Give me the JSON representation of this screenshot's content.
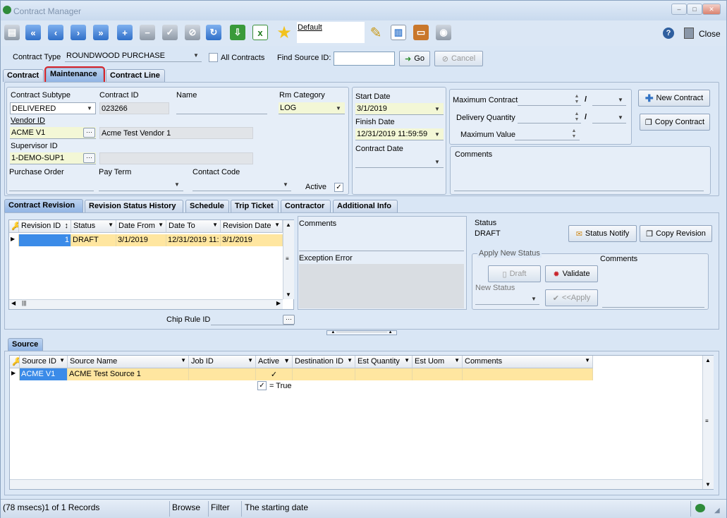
{
  "window": {
    "title": "Contract Manager",
    "close_label": "Close"
  },
  "toolbar": {
    "layout_name": "Default"
  },
  "filterbar": {
    "contract_type_label": "Contract Type",
    "contract_type_value": "ROUNDWOOD PURCHASE",
    "all_contracts_label": "All Contracts",
    "find_source_label": "Find Source ID:",
    "find_source_value": "",
    "go_label": "Go",
    "cancel_label": "Cancel"
  },
  "top_tabs": [
    {
      "label": "Contract"
    },
    {
      "label": "Maintenance"
    },
    {
      "label": "Contract Line"
    }
  ],
  "main": {
    "contract_subtype_label": "Contract Subtype",
    "contract_subtype": "DELIVERED",
    "contract_id_label": "Contract ID",
    "contract_id": "023266",
    "name_label": "Name",
    "name": "",
    "rm_category_label": "Rm Category",
    "rm_category": "LOG",
    "vendor_id_label": "Vendor ID",
    "vendor_id": "ACME V1",
    "vendor_name": "Acme Test Vendor 1",
    "supervisor_id_label": "Supervisor ID",
    "supervisor_id": "1-DEMO-SUP1",
    "supervisor_name": "",
    "purchase_order_label": "Purchase Order",
    "pay_term_label": "Pay Term",
    "contact_code_label": "Contact Code",
    "active_label": "Active",
    "start_date_label": "Start Date",
    "start_date": "3/1/2019",
    "finish_date_label": "Finish Date",
    "finish_date": "12/31/2019 11:59:59",
    "contract_date_label": "Contract Date",
    "contract_date": "",
    "max_contract_label": "Maximum Contract",
    "delivery_qty_label": "Delivery Quantity",
    "max_value_label": "Maximum Value",
    "comments_label": "Comments",
    "new_contract_label": "New Contract",
    "copy_contract_label": "Copy Contract"
  },
  "sub_tabs": [
    {
      "label": "Contract Revision"
    },
    {
      "label": "Revision Status History"
    },
    {
      "label": "Schedule"
    },
    {
      "label": "Trip Ticket"
    },
    {
      "label": "Contractor"
    },
    {
      "label": "Additional Info"
    }
  ],
  "revision": {
    "columns": [
      "Revision ID",
      "Status",
      "Date From",
      "Date To",
      "Revision Date"
    ],
    "rows": [
      {
        "revision_id": "1",
        "status": "DRAFT",
        "date_from": "3/1/2019",
        "date_to": "12/31/2019 11:",
        "revision_date": "3/1/2019"
      }
    ],
    "comments_label": "Comments",
    "exception_label": "Exception Error",
    "status_label": "Status",
    "status_value": "DRAFT",
    "status_notify_label": "Status Notify",
    "copy_revision_label": "Copy Revision",
    "apply_group_label": "Apply New Status",
    "apply_comments_label": "Comments",
    "draft_label": "Draft",
    "validate_label": "Validate",
    "new_status_label": "New Status",
    "apply_label": "<<Apply",
    "chip_rule_label": "Chip Rule ID"
  },
  "source": {
    "tab_label": "Source",
    "columns": [
      "Source ID",
      "Source Name",
      "Job ID",
      "Active",
      "Destination ID",
      "Est Quantity",
      "Est Uom",
      "Comments"
    ],
    "rows": [
      {
        "source_id": "ACME V1",
        "source_name": "ACME Test Source 1",
        "job_id": "",
        "active": "✓",
        "destination_id": "",
        "est_quantity": "",
        "est_uom": "",
        "comments": ""
      }
    ],
    "filter_text": "= True"
  },
  "status": {
    "records": "(78 msecs)1 of 1 Records",
    "mode": "Browse",
    "filter": "Filter",
    "hint": "The starting date"
  }
}
